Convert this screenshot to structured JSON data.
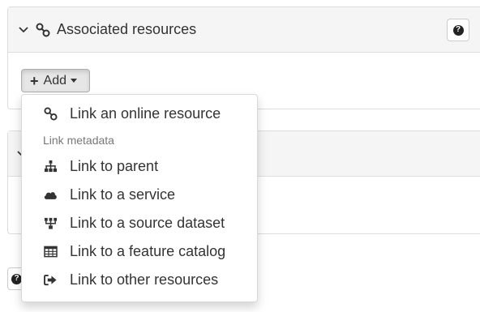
{
  "panel1": {
    "title": "Associated resources",
    "help_label": "?",
    "add_button_label": "Add"
  },
  "bottom_button": {
    "help_label": "?"
  },
  "dropdown": {
    "items": [
      {
        "label": "Link an online resource",
        "icon": "link-icon"
      },
      {
        "label": "Link to parent",
        "icon": "sitemap-icon"
      },
      {
        "label": "Link to a service",
        "icon": "cloud-icon"
      },
      {
        "label": "Link to a source dataset",
        "icon": "source-tree-icon"
      },
      {
        "label": "Link to a feature catalog",
        "icon": "table-icon"
      },
      {
        "label": "Link to other resources",
        "icon": "sign-out-icon"
      }
    ],
    "section_header": "Link metadata"
  }
}
